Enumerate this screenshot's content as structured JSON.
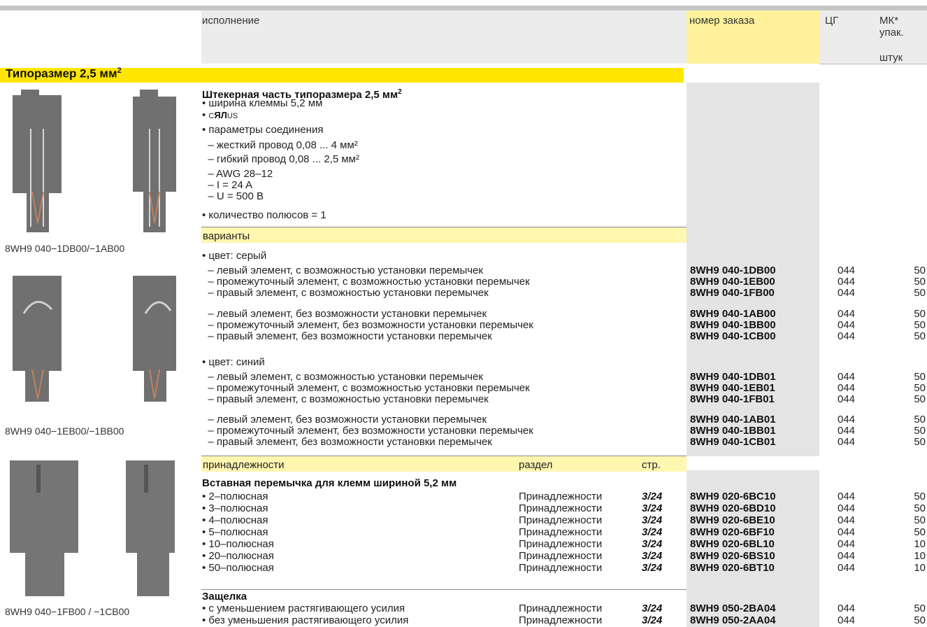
{
  "header": {
    "col_execution": "исполнение",
    "col_order": "номер заказа",
    "col_pg": "ЦГ",
    "col_mk": "МК*",
    "col_pack": "упак.",
    "col_unit": "штук"
  },
  "section": {
    "title": "Типоразмер 2,5 мм",
    "title_sup": "2"
  },
  "captions": {
    "c1": "8WH9 040−1DB00/−1AB00",
    "c2": "8WH9 040−1EB00/−1BB00",
    "c3": "8WH9 040−1FB00 / −1CB00"
  },
  "plug": {
    "title": "Штекерная часть типоразмера 2,5 мм",
    "title_sup": "2",
    "lines": [
      "• ширина клеммы 5,2 мм",
      "• ",
      "• параметры соединения",
      "  – жесткий провод 0,08 ... 4 мм²",
      "  – гибкий провод 0,08 ... 2,5 мм²",
      "  – AWG 28–12",
      "  – I = 24 A",
      "  – U = 500 B",
      "• количество полюсов = 1"
    ],
    "cert_c": "C",
    "cert_logo": "ЯЛ",
    "cert_us": "US"
  },
  "variants": {
    "label": "варианты",
    "grey_label": "• цвет: серый",
    "blue_label": "• цвет: синий",
    "rows": [
      {
        "desc": "  – левый элемент, с возможностью установки перемычек",
        "order": "8WH9 040-1DB00",
        "pg": "044",
        "qty": "50"
      },
      {
        "desc": "  – промежуточный элемент, с возможностью установки перемычек",
        "order": "8WH9 040-1EB00",
        "pg": "044",
        "qty": "50"
      },
      {
        "desc": "  – правый элемент, с возможностью установки перемычек",
        "order": "8WH9 040-1FB00",
        "pg": "044",
        "qty": "50"
      },
      {
        "desc": "  – левый элемент, без возможности установки перемычек",
        "order": "8WH9 040-1AB00",
        "pg": "044",
        "qty": "50"
      },
      {
        "desc": "  – промежуточный элемент, без возможности установки перемычек",
        "order": "8WH9 040-1BB00",
        "pg": "044",
        "qty": "50"
      },
      {
        "desc": "  – правый элемент, без возможности установки перемычек",
        "order": "8WH9 040-1CB00",
        "pg": "044",
        "qty": "50"
      },
      {
        "desc": "  – левый элемент, с возможностью установки перемычек",
        "order": "8WH9 040-1DB01",
        "pg": "044",
        "qty": "50"
      },
      {
        "desc": "  – промежуточный элемент, с возможностью установки перемычек",
        "order": "8WH9 040-1EB01",
        "pg": "044",
        "qty": "50"
      },
      {
        "desc": "  – правый элемент, с возможностью установки перемычек",
        "order": "8WH9 040-1FB01",
        "pg": "044",
        "qty": "50"
      },
      {
        "desc": "  – левый элемент, без возможности установки перемычек",
        "order": "8WH9 040-1AB01",
        "pg": "044",
        "qty": "50"
      },
      {
        "desc": "  – промежуточный элемент, без возможности установки перемычек",
        "order": "8WH9 040-1BB01",
        "pg": "044",
        "qty": "50"
      },
      {
        "desc": "  – правый элемент, без возможности установки перемычек",
        "order": "8WH9 040-1CB01",
        "pg": "044",
        "qty": "50"
      }
    ]
  },
  "accessories": {
    "label": "принадлежности",
    "col_section": "раздел",
    "col_page": "стр.",
    "bridge_title": "Вставная перемычка для клемм шириной 5,2 мм",
    "bridge_rows": [
      {
        "desc": "• 2–полюсная",
        "section": "Принадлежности",
        "page": "3/24",
        "order": "8WH9 020-6BC10",
        "pg": "044",
        "qty": "50"
      },
      {
        "desc": "• 3–полюсная",
        "section": "Принадлежности",
        "page": "3/24",
        "order": "8WH9 020-6BD10",
        "pg": "044",
        "qty": "50"
      },
      {
        "desc": "• 4–полюсная",
        "section": "Принадлежности",
        "page": "3/24",
        "order": "8WH9 020-6BE10",
        "pg": "044",
        "qty": "50"
      },
      {
        "desc": "• 5–полюсная",
        "section": "Принадлежности",
        "page": "3/24",
        "order": "8WH9 020-6BF10",
        "pg": "044",
        "qty": "50"
      },
      {
        "desc": "• 10–полюсная",
        "section": "Принадлежности",
        "page": "3/24",
        "order": "8WH9 020-6BL10",
        "pg": "044",
        "qty": "10"
      },
      {
        "desc": "• 20–полюсная",
        "section": "Принадлежности",
        "page": "3/24",
        "order": "8WH9 020-6BS10",
        "pg": "044",
        "qty": "10"
      },
      {
        "desc": "• 50–полюсная",
        "section": "Принадлежности",
        "page": "3/24",
        "order": "8WH9 020-6BT10",
        "pg": "044",
        "qty": "10"
      }
    ],
    "latch_title": "Защелка",
    "latch_rows": [
      {
        "desc": "• с уменьшением растягивающего усилия",
        "section": "Принадлежности",
        "page": "3/24",
        "order": "8WH9 050-2BA04",
        "pg": "044",
        "qty": "50"
      },
      {
        "desc": "• без уменьшения растягивающего усилия",
        "section": "Принадлежности",
        "page": "3/24",
        "order": "8WH9 050-2AA04",
        "pg": "044",
        "qty": "50"
      }
    ]
  }
}
